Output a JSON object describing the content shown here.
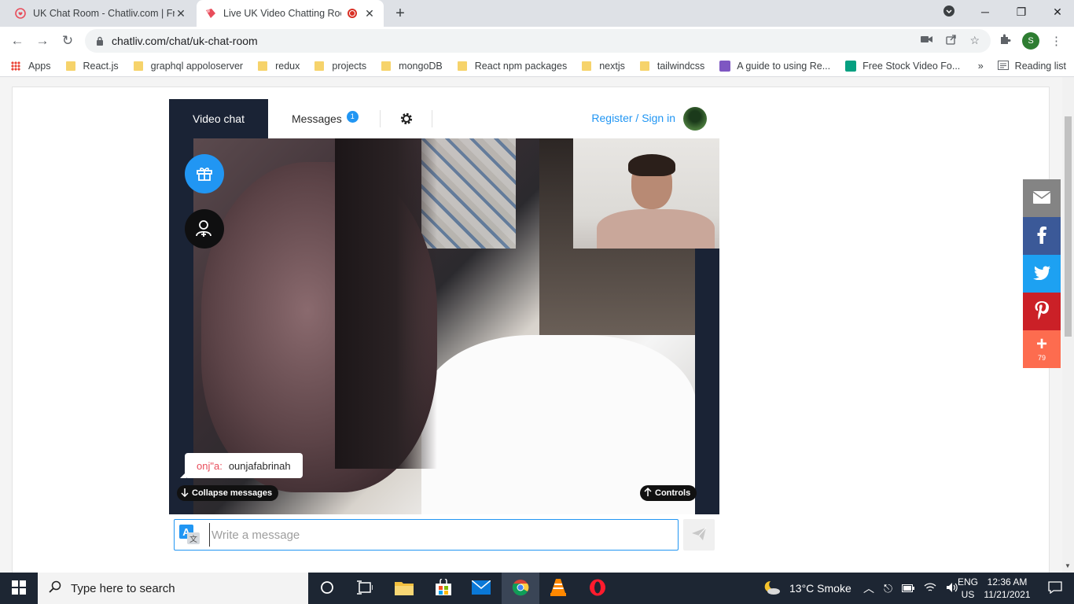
{
  "browser": {
    "tabs": [
      {
        "title": "UK Chat Room - Chatliv.com | Fre",
        "active": false
      },
      {
        "title": "Live UK Video Chatting Roon",
        "active": true
      }
    ],
    "url": "chatliv.com/chat/uk-chat-room",
    "profile_initial": "S"
  },
  "bookmarks": {
    "items": [
      "Apps",
      "React.js",
      "graphql appoloserver",
      "redux",
      "projects",
      "mongoDB",
      "React npm packages",
      "nextjs",
      "tailwindcss",
      "A guide to using Re...",
      "Free Stock Video Fo..."
    ],
    "overflow": "»",
    "reading_list": "Reading list"
  },
  "chat": {
    "tab_video": "Video chat",
    "tab_messages": "Messages",
    "messages_badge": "1",
    "register_label": "Register / Sign in",
    "message": {
      "user": "onj\"a:",
      "text": "ounjafabrinah"
    },
    "collapse_label": "Collapse messages",
    "controls_label": "Controls",
    "input_placeholder": "Write a message"
  },
  "share": {
    "count": "79",
    "colors": {
      "email": "#848484",
      "facebook": "#3b5998",
      "twitter": "#1da1f2",
      "pinterest": "#cb2027",
      "more": "#fd6c4f"
    }
  },
  "taskbar": {
    "search_placeholder": "Type here to search",
    "weather": "13°C  Smoke",
    "lang_1": "ENG",
    "lang_2": "US",
    "time": "12:36 AM",
    "date": "11/21/2021"
  },
  "colors": {
    "accent": "#2196f3",
    "dark_panel": "#1a2335",
    "username": "#e84d5b"
  }
}
